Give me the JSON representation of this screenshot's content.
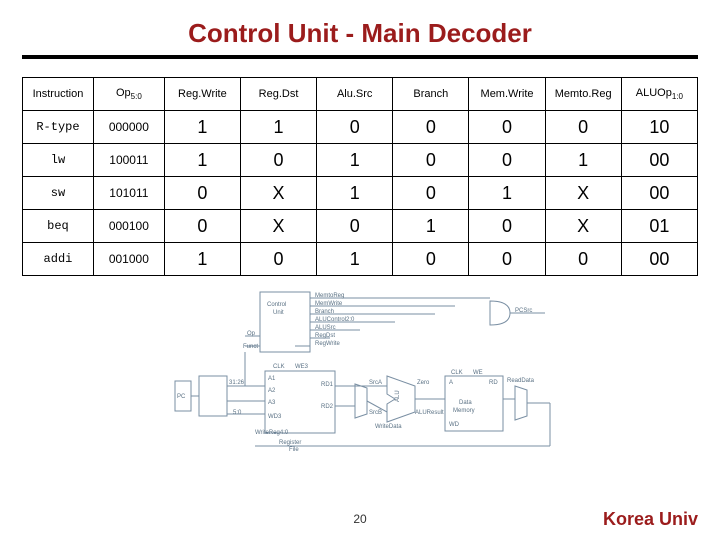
{
  "title": "Control Unit - Main Decoder",
  "table": {
    "headers": [
      "Instruction",
      "Op5:0",
      "Reg.Write",
      "Reg.Dst",
      "Alu.Src",
      "Branch",
      "Mem.Write",
      "Memto.Reg",
      "ALUOp1:0"
    ],
    "rows": [
      {
        "instr": "R-type",
        "op": "000000",
        "v": [
          "1",
          "1",
          "0",
          "0",
          "0",
          "0",
          "10"
        ]
      },
      {
        "instr": "lw",
        "op": "100011",
        "v": [
          "1",
          "0",
          "1",
          "0",
          "0",
          "1",
          "00"
        ]
      },
      {
        "instr": "sw",
        "op": "101011",
        "v": [
          "0",
          "X",
          "1",
          "0",
          "1",
          "X",
          "00"
        ]
      },
      {
        "instr": "beq",
        "op": "000100",
        "v": [
          "0",
          "X",
          "0",
          "1",
          "0",
          "X",
          "01"
        ]
      },
      {
        "instr": "addi",
        "op": "001000",
        "v": [
          "1",
          "0",
          "1",
          "0",
          "0",
          "0",
          "00"
        ]
      }
    ]
  },
  "diagram": {
    "control_unit": "Control\nUnit",
    "signals": [
      "MemtoReg",
      "MemWrite",
      "Branch",
      "ALUControl2:0",
      "ALUSrc",
      "RegDst",
      "RegWrite"
    ],
    "inputs": [
      "Op",
      "Funct"
    ],
    "sideport": "31:26",
    "sideport2": "5:0",
    "pc": "PC",
    "regfile": "Register\nFile",
    "regfile_ports": [
      "A1",
      "A2",
      "A3",
      "WD3",
      "WE3",
      "RD1",
      "RD2",
      "CLK"
    ],
    "alu_ports": [
      "SrcA",
      "SrcB",
      "ALU",
      "Zero",
      "ALUResult"
    ],
    "mem": "Data\nMemory",
    "mem_ports": [
      "A",
      "RD",
      "WD",
      "WE",
      "CLK"
    ],
    "writereg": "WriteReg4:0",
    "writedata": "WriteData",
    "readdata": "ReadData",
    "pcsrc": "PCSrc"
  },
  "page_number": "20",
  "brand": "Korea Univ"
}
